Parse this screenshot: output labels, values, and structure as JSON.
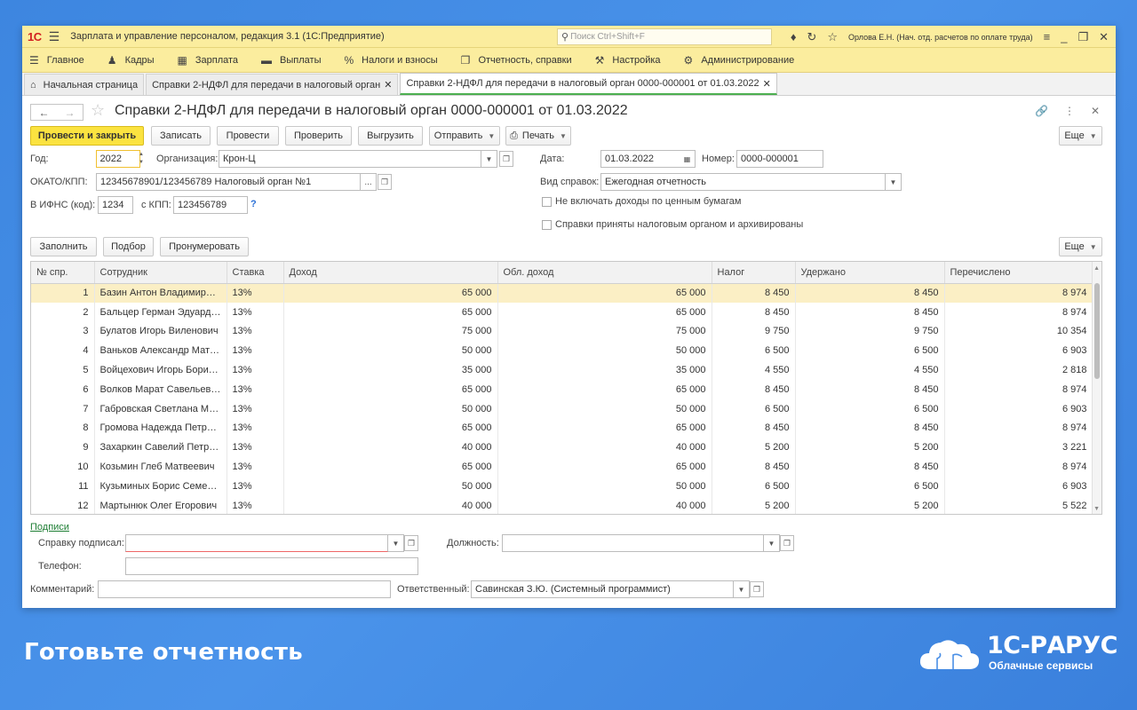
{
  "app": {
    "logo": "1С",
    "title": "Зарплата и управление персоналом, редакция 3.1  (1С:Предприятие)",
    "search_placeholder": "Поиск Ctrl+Shift+F",
    "user": "Орлова Е.Н. (Нач. отд. расчетов по оплате труда)"
  },
  "menu": [
    {
      "label": "Главное",
      "icon": "hamburger-icon"
    },
    {
      "label": "Кадры",
      "icon": "people-icon"
    },
    {
      "label": "Зарплата",
      "icon": "calculator-icon"
    },
    {
      "label": "Выплаты",
      "icon": "wallet-icon"
    },
    {
      "label": "Налоги и взносы",
      "icon": "percent-icon"
    },
    {
      "label": "Отчетность, справки",
      "icon": "documents-icon"
    },
    {
      "label": "Настройка",
      "icon": "wrench-icon"
    },
    {
      "label": "Администрирование",
      "icon": "gear-icon"
    }
  ],
  "tabs": {
    "home": "Начальная страница",
    "tab1": "Справки 2-НДФЛ для передачи в налоговый орган",
    "tab2": "Справки 2-НДФЛ для передачи в налоговый орган 0000-000001 от 01.03.2022"
  },
  "form": {
    "title": "Справки 2-НДФЛ для передачи в налоговый орган 0000-000001 от 01.03.2022",
    "buttons": {
      "post_close": "Провести и закрыть",
      "save": "Записать",
      "post": "Провести",
      "check": "Проверить",
      "export": "Выгрузить",
      "send": "Отправить",
      "print": "Печать",
      "more": "Еще"
    },
    "fields": {
      "year_label": "Год:",
      "year": "2022",
      "org_label": "Организация:",
      "org": "Крон-Ц",
      "date_label": "Дата:",
      "date": "01.03.2022",
      "number_label": "Номер:",
      "number": "0000-000001",
      "okato_label": "ОКАТО/КПП:",
      "okato": "12345678901/123456789 Налоговый орган №1",
      "type_label": "Вид справок:",
      "type": "Ежегодная отчетность",
      "ifns_label": "В ИФНС (код):",
      "ifns": "1234",
      "kpp_label": "с КПП:",
      "kpp": "123456789",
      "help": "?",
      "chk1": "Не включать доходы по ценным бумагам",
      "chk2": "Справки приняты налоговым органом и архивированы"
    },
    "table_buttons": {
      "fill": "Заполнить",
      "select": "Подбор",
      "number": "Пронумеровать",
      "more": "Еще"
    },
    "table": {
      "columns": [
        "№ спр.",
        "Сотрудник",
        "Ставка",
        "Доход",
        "Обл. доход",
        "Налог",
        "Удержано",
        "Перечислено"
      ],
      "rows": [
        [
          "1",
          "Базин Антон Владимирович",
          "13%",
          "65 000",
          "65 000",
          "8 450",
          "8 450",
          "8 974"
        ],
        [
          "2",
          "Бальцер Герман Эдуардович",
          "13%",
          "65 000",
          "65 000",
          "8 450",
          "8 450",
          "8 974"
        ],
        [
          "3",
          "Булатов Игорь Виленович",
          "13%",
          "75 000",
          "75 000",
          "9 750",
          "9 750",
          "10 354"
        ],
        [
          "4",
          "Ваньков Александр Матвеевич",
          "13%",
          "50 000",
          "50 000",
          "6 500",
          "6 500",
          "6 903"
        ],
        [
          "5",
          "Войцехович Игорь Борисович",
          "13%",
          "35 000",
          "35 000",
          "4 550",
          "4 550",
          "2 818"
        ],
        [
          "6",
          "Волков Марат Савельевич",
          "13%",
          "65 000",
          "65 000",
          "8 450",
          "8 450",
          "8 974"
        ],
        [
          "7",
          "Габровская Светлана Марковна",
          "13%",
          "50 000",
          "50 000",
          "6 500",
          "6 500",
          "6 903"
        ],
        [
          "8",
          "Громова Надежда Петровна",
          "13%",
          "65 000",
          "65 000",
          "8 450",
          "8 450",
          "8 974"
        ],
        [
          "9",
          "Захаркин Савелий Петрович",
          "13%",
          "40 000",
          "40 000",
          "5 200",
          "5 200",
          "3 221"
        ],
        [
          "10",
          "Козьмин Глеб Матвеевич",
          "13%",
          "65 000",
          "65 000",
          "8 450",
          "8 450",
          "8 974"
        ],
        [
          "11",
          "Кузьминых Борис Семенович",
          "13%",
          "50 000",
          "50 000",
          "6 500",
          "6 500",
          "6 903"
        ],
        [
          "12",
          "Мартынюк Олег Егорович",
          "13%",
          "40 000",
          "40 000",
          "5 200",
          "5 200",
          "5 522"
        ]
      ]
    },
    "signatures": {
      "link": "Подписи",
      "signed_label": "Справку подписал:",
      "signed": "",
      "position_label": "Должность:",
      "position": "",
      "phone_label": "Телефон:",
      "phone": "",
      "comment_label": "Комментарий:",
      "comment": "",
      "responsible_label": "Ответственный:",
      "responsible": "Савинская З.Ю. (Системный программист)"
    }
  },
  "promo": {
    "slogan": "Готовьте отчетность",
    "brand": "1С-РАРУС",
    "brand_sub": "Облачные сервисы"
  }
}
